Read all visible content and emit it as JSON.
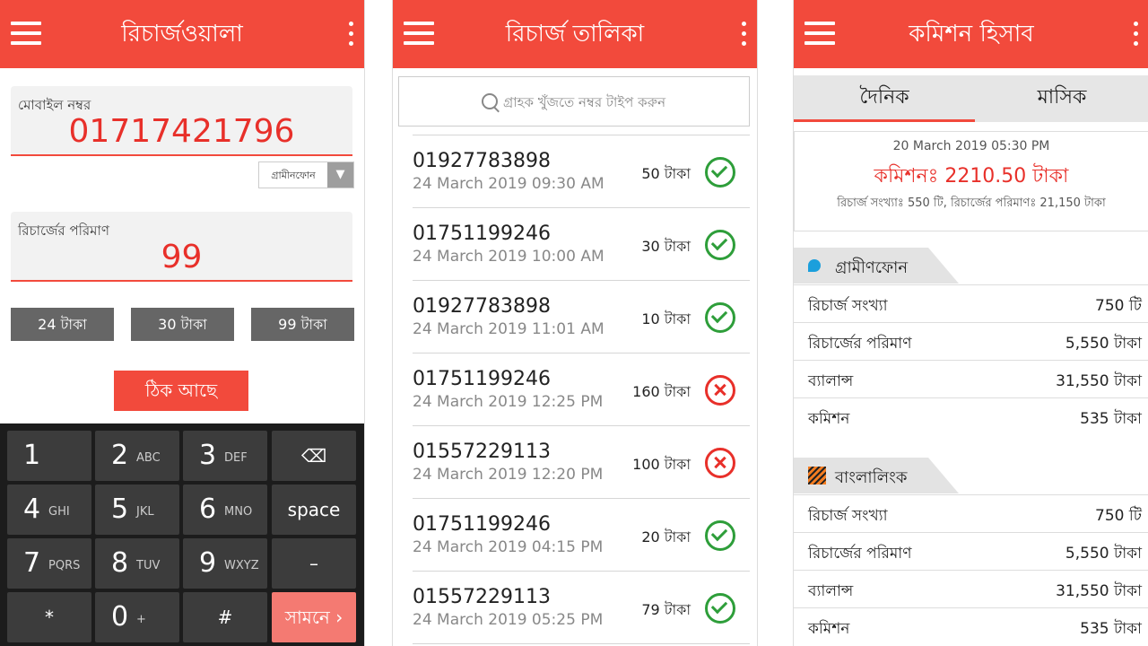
{
  "screen1": {
    "title": "রিচার্জওয়ালা",
    "mobile_label": "মোবাইল নম্বর",
    "mobile_value": "01717421796",
    "operator": "গ্রামীনফোন",
    "amount_label": "রিচার্জের পরিমাণ",
    "amount_value": "99",
    "quick_amounts": [
      "24 টাকা",
      "30 টাকা",
      "99 টাকা"
    ],
    "ok_button": "ঠিক আছে",
    "keys": [
      {
        "n": "1",
        "s": ""
      },
      {
        "n": "2",
        "s": "ABC"
      },
      {
        "n": "3",
        "s": "DEF"
      },
      {
        "c": "⌫"
      },
      {
        "n": "4",
        "s": "GHI"
      },
      {
        "n": "5",
        "s": "JKL"
      },
      {
        "n": "6",
        "s": "MNO"
      },
      {
        "c": "space"
      },
      {
        "n": "7",
        "s": "PQRS"
      },
      {
        "n": "8",
        "s": "TUV"
      },
      {
        "n": "9",
        "s": "WXYZ"
      },
      {
        "c": "–"
      },
      {
        "c": "*"
      },
      {
        "n": "0",
        "s": "+"
      },
      {
        "c": "#"
      },
      {
        "c": "সামনে ›"
      }
    ]
  },
  "screen2": {
    "title": "রিচার্জ তালিকা",
    "search_placeholder": "গ্রাহক খুঁজতে নম্বর টাইপ করুন",
    "rows": [
      {
        "phone": "01927783898",
        "time": "24 March 2019 09:30 AM",
        "amount": "50 টাকা",
        "status": "success"
      },
      {
        "phone": "01751199246",
        "time": "24 March 2019 10:00 AM",
        "amount": "30 টাকা",
        "status": "success"
      },
      {
        "phone": "01927783898",
        "time": "24 March 2019 11:01 AM",
        "amount": "10 টাকা",
        "status": "success"
      },
      {
        "phone": "01751199246",
        "time": "24 March 2019 12:25 PM",
        "amount": "160 টাকা",
        "status": "failed"
      },
      {
        "phone": "01557229113",
        "time": "24 March 2019 12:20 PM",
        "amount": "100 টাকা",
        "status": "failed"
      },
      {
        "phone": "01751199246",
        "time": "24 March 2019 04:15 PM",
        "amount": "20 টাকা",
        "status": "success"
      },
      {
        "phone": "01557229113",
        "time": "24 March 2019 05:25 PM",
        "amount": "79 টাকা",
        "status": "success"
      }
    ]
  },
  "screen3": {
    "title": "কমিশন হিসাব",
    "tabs": {
      "daily": "দৈনিক",
      "monthly": "মাসিক"
    },
    "summary": {
      "date": "20 March 2019 05:30 PM",
      "commission": "কমিশনঃ 2210.50 টাকা",
      "sub": "রিচার্জ সংখ্যাঃ 550 টি, রিচার্জের পরিমাণঃ 21,150 টাকা"
    },
    "sections": [
      {
        "name": "গ্রামীণফোন",
        "logo": "grameenphone-logo",
        "rows": [
          {
            "k": "রিচার্জ সংখ্যা",
            "v": "750 টি"
          },
          {
            "k": "রিচার্জের পরিমাণ",
            "v": "5,550 টাকা"
          },
          {
            "k": "ব্যালান্স",
            "v": "31,550 টাকা"
          },
          {
            "k": "কমিশন",
            "v": "535 টাকা"
          }
        ]
      },
      {
        "name": "বাংলালিংক",
        "logo": "banglalink-logo",
        "rows": [
          {
            "k": "রিচার্জ সংখ্যা",
            "v": "750 টি"
          },
          {
            "k": "রিচার্জের পরিমাণ",
            "v": "5,550 টাকা"
          },
          {
            "k": "ব্যালান্স",
            "v": "31,550 টাকা"
          },
          {
            "k": "কমিশন",
            "v": "535 টাকা"
          }
        ]
      }
    ]
  },
  "colors": {
    "accent": "#f24a3c",
    "success": "#2e9e3a",
    "failed": "#e8302a"
  }
}
